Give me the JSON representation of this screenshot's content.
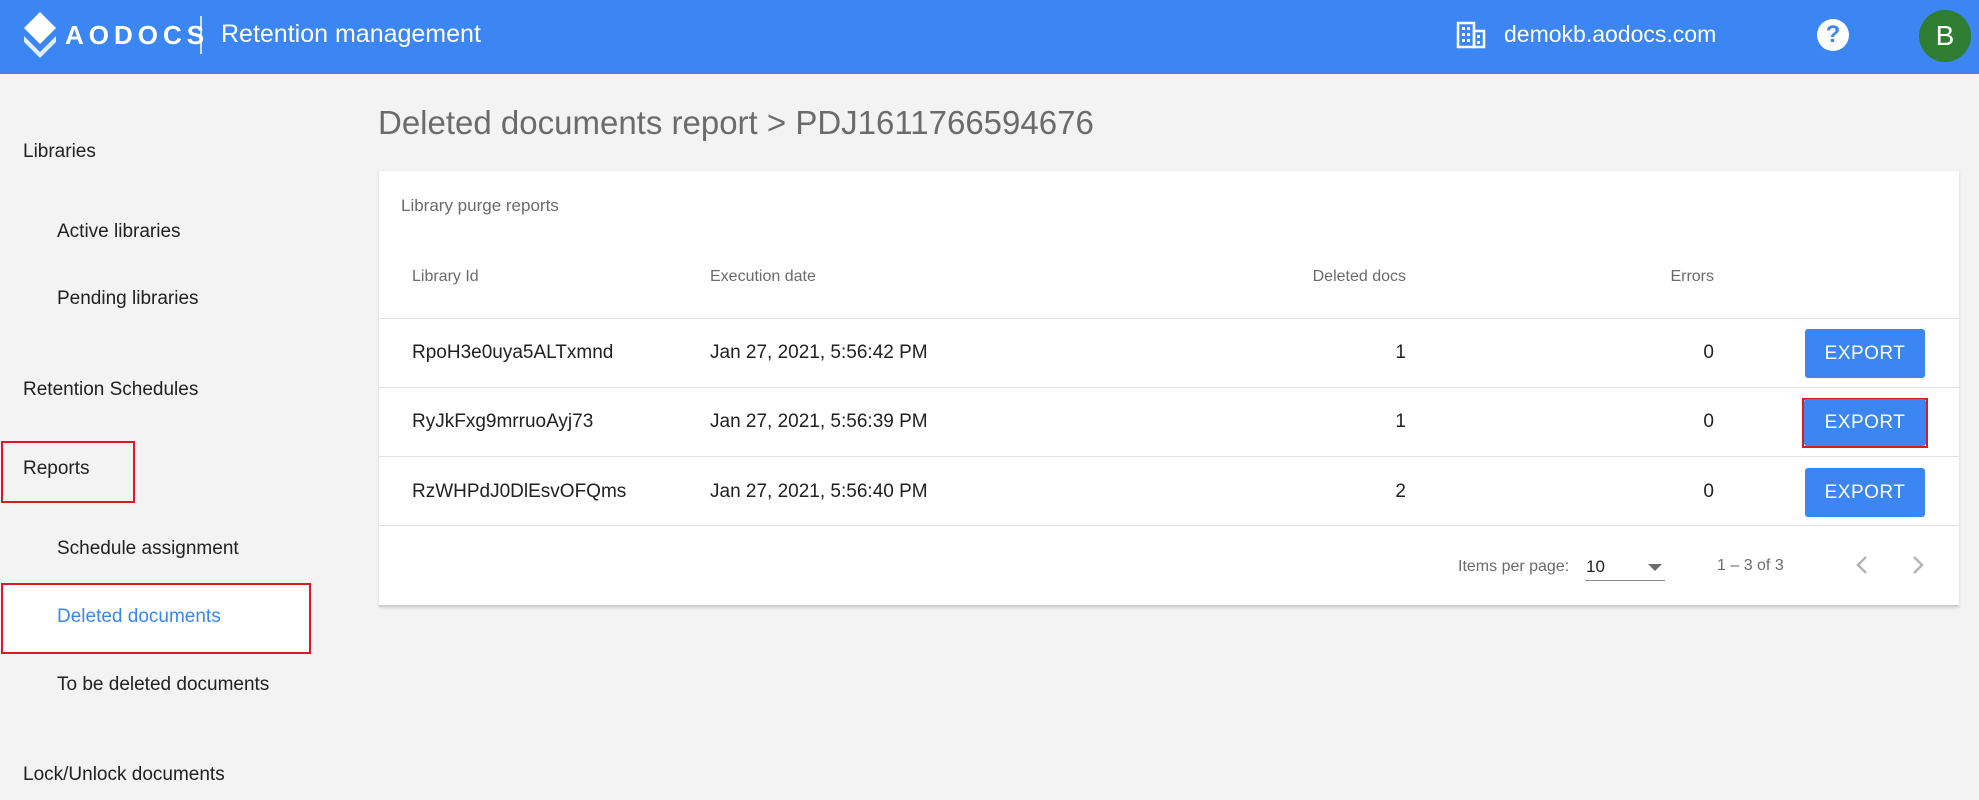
{
  "header": {
    "brand": "AODOCS",
    "app_title": "Retention management",
    "domain": "demokb.aodocs.com",
    "help": "?",
    "avatar_initial": "B",
    "colors": {
      "bar": "#3b86f2",
      "avatar": "#2e7d32"
    }
  },
  "sidebar": {
    "libraries": "Libraries",
    "active_libraries": "Active libraries",
    "pending_libraries": "Pending libraries",
    "retention_schedules": "Retention Schedules",
    "reports": "Reports",
    "schedule_assignment": "Schedule assignment",
    "deleted_documents": "Deleted documents",
    "to_be_deleted_documents": "To be deleted documents",
    "lock_unlock_documents": "Lock/Unlock documents"
  },
  "main": {
    "page_title": "Deleted documents report > PDJ1611766594676",
    "card_title": "Library purge reports",
    "columns": {
      "library_id": "Library Id",
      "execution_date": "Execution date",
      "deleted_docs": "Deleted docs",
      "errors": "Errors"
    },
    "rows": [
      {
        "library_id": "RpoH3e0uya5ALTxmnd",
        "execution_date": "Jan 27, 2021, 5:56:42 PM",
        "deleted_docs": "1",
        "errors": "0",
        "action": "EXPORT"
      },
      {
        "library_id": "RyJkFxg9mrruoAyj73",
        "execution_date": "Jan 27, 2021, 5:56:39 PM",
        "deleted_docs": "1",
        "errors": "0",
        "action": "EXPORT"
      },
      {
        "library_id": "RzWHPdJ0DlEsvOFQms",
        "execution_date": "Jan 27, 2021, 5:56:40 PM",
        "deleted_docs": "2",
        "errors": "0",
        "action": "EXPORT"
      }
    ],
    "paginator": {
      "items_per_page_label": "Items per page:",
      "items_per_page_value": "10",
      "range": "1 – 3 of 3"
    }
  }
}
